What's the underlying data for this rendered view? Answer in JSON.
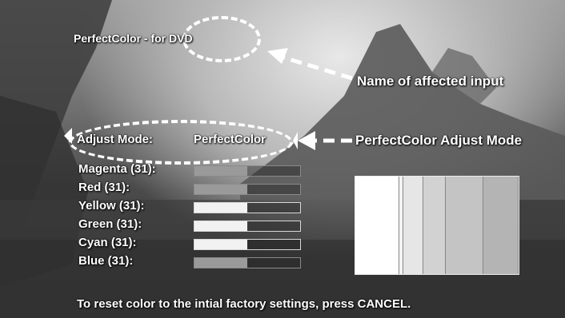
{
  "header": {
    "input_name": "PerfectColor - for DVD"
  },
  "callouts": {
    "affected_input": "Name of affected input",
    "adjust_mode": "PerfectColor Adjust Mode"
  },
  "adjust_mode": {
    "label": "Adjust Mode:",
    "value": "PerfectColor"
  },
  "colors": [
    {
      "label": "Magenta (31):",
      "level": 0.5,
      "dim": true
    },
    {
      "label": "Red (31):",
      "level": 0.5,
      "dim": true
    },
    {
      "label": "Yellow (31):",
      "level": 0.5,
      "dim": false
    },
    {
      "label": "Green (31):",
      "level": 0.5,
      "dim": false
    },
    {
      "label": "Cyan (31):",
      "level": 0.5,
      "dim": false
    },
    {
      "label": "Blue (31):",
      "level": 0.5,
      "dim": true
    }
  ],
  "preview_stripes": [
    "#ffffff",
    "#f4f4f4",
    "#e6e6e6",
    "#d2d2d2",
    "#c4c4c4",
    "#b4b4b4"
  ],
  "footer": {
    "hint": "To reset color to the intial factory settings, press CANCEL."
  }
}
